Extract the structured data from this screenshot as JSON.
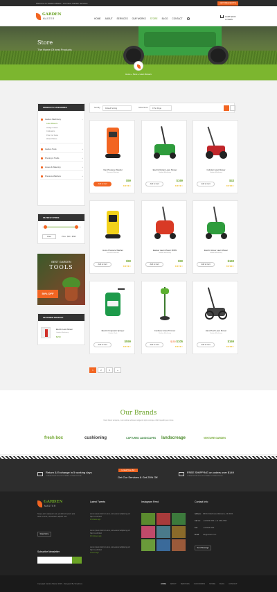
{
  "topbar": {
    "welcome": "Welcome to Garden Master - Premium Garden Services",
    "contact": "+12 3456-7890  |  info@domain.com",
    "quote_btn": "GET FREE QUOTE"
  },
  "header": {
    "logo_line1": "GARDEN",
    "logo_line2": "MASTER",
    "nav": [
      "HOME",
      "ABOUT",
      "SERVICES",
      "OUR WORKS",
      "STORE",
      "BLOG",
      "CONTACT"
    ],
    "active_nav": "STORE",
    "cart_label": "CART",
    "cart_total": "$0.00",
    "cart_items": "0 ITEMS"
  },
  "hero": {
    "title": "Store",
    "subtitle": "The Home Of best Products"
  },
  "breadcrumb": [
    "Home",
    "Store",
    "Lawn Mowers"
  ],
  "sidebar": {
    "categories_title": "PRODUCTS CATEGORIES",
    "categories": [
      {
        "label": "Garden Machinery",
        "open": true,
        "children": [
          "Lawn Mowers",
          "Hedge Cutters",
          "Cultivators",
          "Pole Cut Saws",
          "Weed Pullers"
        ],
        "active_child": "Lawn Mowers"
      },
      {
        "label": "Garden Tools"
      },
      {
        "label": "Pruning & Trellis"
      },
      {
        "label": "Hoses & Watering"
      },
      {
        "label": "Pressure Washers"
      }
    ],
    "filter_title": "FILTER BY PRICE",
    "filter_btn": "Filter",
    "price_label": "Price : $60 - $595",
    "price_range": {
      "min": 60,
      "max": 595,
      "fill_from": 0.07,
      "fill_to": 0.9
    },
    "promo": {
      "line1": "BEST GARDEN",
      "line2": "TOOLS",
      "badge": "50% OFF"
    },
    "featured_title": "FEATURED PRODUCT",
    "featured": {
      "name": "Electric Lawn Mower",
      "cat": "Garden Machinery",
      "price": "$250"
    }
  },
  "toolbar": {
    "sort_label": "Sort By",
    "sort_value": "Default Sorting",
    "show_label": "Show Items",
    "show_value": "9 Per Page"
  },
  "products": [
    {
      "name": "Vian Pressure Washer",
      "cat": "Pressure Washers",
      "old": "",
      "price": "$59",
      "add": "Add to Cart",
      "hot": true,
      "img": "washer-orange"
    },
    {
      "name": "Electric Rotary Lawn Mower",
      "cat": "Garden Machinery",
      "old": "",
      "price": "$169",
      "add": "Add to Cart",
      "hot": false,
      "img": "mower-green"
    },
    {
      "name": "Cylinder Lawn Mower",
      "cat": "Garden Machinery",
      "old": "",
      "price": "$43",
      "add": "Add to Cart",
      "hot": false,
      "img": "mower-reel"
    },
    {
      "name": "Home Pressure Washer",
      "cat": "Pressure Washers",
      "old": "",
      "price": "$59",
      "add": "Add to Cart",
      "hot": false,
      "img": "washer-yellow"
    },
    {
      "name": "Easiser Lawn Mower 800W",
      "cat": "Garden Machinery",
      "old": "",
      "price": "$59",
      "add": "Add to Cart",
      "hot": false,
      "img": "trimmer-red"
    },
    {
      "name": "Electric Hover Lawn Mower",
      "cat": "Garden Machinery",
      "old": "",
      "price": "$169",
      "add": "Add to Cart",
      "hot": false,
      "img": "mower-hover"
    },
    {
      "name": "Electric Knapsack Sprayer",
      "cat": "Garden Tools",
      "old": "",
      "price": "$559",
      "add": "Add to Cart",
      "hot": false,
      "img": "sprayer"
    },
    {
      "name": "Cordless Grass Trimmer",
      "cat": "Garden Machinery",
      "old": "$150",
      "price": "$105",
      "add": "Add to Cart",
      "hot": false,
      "img": "trimmer-green"
    },
    {
      "name": "Hand Push Lawn Mower",
      "cat": "Garden Machinery",
      "old": "",
      "price": "$169",
      "add": "Add to Cart",
      "hot": false,
      "img": "mower-push"
    }
  ],
  "pagination": {
    "pages": [
      "1",
      "2",
      "3",
      "»"
    ],
    "active": "1"
  },
  "brands": {
    "title": "Our Brands",
    "subtitle": "Nam libero tempore, cum soluta nobis est eligendi optio cumque nihil impedit quo minus",
    "items": [
      {
        "name": "fresh box",
        "color": "#6aa225"
      },
      {
        "name": "cushioning",
        "color": "#333333"
      },
      {
        "name": "CAPTURED LANDSCAPES",
        "color": "#2e7d32"
      },
      {
        "name": "landscreage",
        "color": "#4a8a2a"
      },
      {
        "name": "VENTURE GARDEN",
        "color": "#6aa225"
      }
    ]
  },
  "stripe": {
    "left_title": "Return & Exchange in 5 working days",
    "left_sub": "LOREM IPSUM DOLOR SIT AMET CONSECTETUR",
    "tag": "Limited Time offer",
    "mid_title": "Get Our Services & Get 25% Off",
    "right_title": "FREE SHIPPING on orders over $149",
    "right_sub": "LOREM IPSUM DOLOR SIT AMET CONSECTETUR"
  },
  "footer": {
    "about": "Neque porro quisquam est, qui dolorem ipsum quia dolor sit amet, consectetur, adipisci velit.",
    "read_more": "Read More",
    "subscribe_title": "Subscribe Newsletter",
    "tweets_title": "Latest Tweets",
    "tweets": [
      {
        "text": "Lorem ipsum dolor sit amet, consectetur adipiscing elit http://t.co/U3xrd",
        "time": "2 minutes ago"
      },
      {
        "text": "Lorem ipsum dolor sit amet, consectetur adipiscing elit http://t.co/U3xrd",
        "time": "16 minutes ago"
      },
      {
        "text": "Lorem ipsum dolor sit amet, consectetur adipiscing elit http://t.co/U3xrd",
        "time": "3 hours ago"
      }
    ],
    "insta_title": "Instagram Feed",
    "insta_colors": [
      "#5a8a2e",
      "#a83b3b",
      "#3c7a3c",
      "#c04a6a",
      "#4a7a8a",
      "#8a6a2a",
      "#6a9a3a",
      "#3a6a9a",
      "#9a5a3a"
    ],
    "contact_title": "Contact Info",
    "contact": [
      {
        "k": "Address:",
        "v": "380 St Kilda Road, Melbourne, VIC 3004"
      },
      {
        "k": "Call Us:",
        "v": "+12 3456-7890 / +12 3456-7890"
      },
      {
        "k": "Fax:",
        "v": "+12 3456-7890"
      },
      {
        "k": "Email:",
        "v": "info@domain.com"
      }
    ],
    "send_msg": "Send Message"
  },
  "bottom": {
    "copyright": "Copyright Garden Master 2016 - Designed By Templines",
    "nav": [
      "HOME",
      "ABOUT",
      "SERVICES",
      "OUR WORKS",
      "STORE",
      "BLOG",
      "CONTACT"
    ],
    "active": "HOME"
  },
  "colors": {
    "accent": "#6aa225",
    "orange": "#f26522",
    "dark": "#2b2b2b"
  }
}
